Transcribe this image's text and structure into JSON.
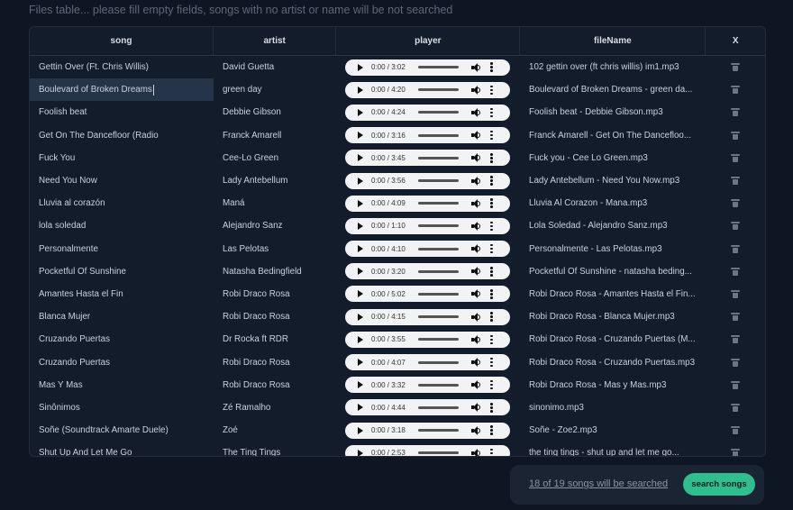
{
  "hint": "Files table... please fill empty fields, songs with no artist or name will be not searched",
  "columns": {
    "song": "song",
    "artist": "artist",
    "player": "player",
    "file": "fileName",
    "x": "X"
  },
  "rows": [
    {
      "song": "Gettin Over (Ft. Chris Willis)",
      "artist": "David Guetta",
      "time": "0:00 / 3:02",
      "file": "102 gettin over (ft chris willis) im1.mp3"
    },
    {
      "song": "Boulevard of Broken Dreams",
      "artist": "green day",
      "time": "0:00 / 4:20",
      "file": "Boulevard of Broken Dreams - green da..."
    },
    {
      "song": "Foolish beat",
      "artist": "Debbie Gibson",
      "time": "0:00 / 4:24",
      "file": "Foolish beat - Debbie Gibson.mp3"
    },
    {
      "song": "Get On The Dancefloor (Radio",
      "artist": "Franck Amarell",
      "time": "0:00 / 3:16",
      "file": "Franck Amarell - Get On The Dancefloo..."
    },
    {
      "song": "Fuck You",
      "artist": "Cee-Lo Green",
      "time": "0:00 / 3:45",
      "file": "Fuck you - Cee Lo Green.mp3"
    },
    {
      "song": "Need You Now",
      "artist": "Lady Antebellum",
      "time": "0:00 / 3:56",
      "file": "Lady Antebellum - Need You Now.mp3"
    },
    {
      "song": "Lluvia al corazón",
      "artist": "Maná",
      "time": "0:00 / 4:09",
      "file": "Lluvia Al Corazon - Mana.mp3"
    },
    {
      "song": "lola soledad",
      "artist": "Alejandro Sanz",
      "time": "0:00 / 1:10",
      "file": "Lola Soledad - Alejandro Sanz.mp3"
    },
    {
      "song": "Personalmente",
      "artist": "Las Pelotas",
      "time": "0:00 / 4:10",
      "file": "Personalmente - Las Pelotas.mp3"
    },
    {
      "song": "Pocketful Of Sunshine",
      "artist": "Natasha Bedingfield",
      "time": "0:00 / 3:20",
      "file": "Pocketful Of Sunshine - natasha beding..."
    },
    {
      "song": "Amantes Hasta el Fin",
      "artist": "Robi Draco Rosa",
      "time": "0:00 / 5:02",
      "file": "Robi Draco Rosa - Amantes Hasta el Fin..."
    },
    {
      "song": "Blanca Mujer",
      "artist": "Robi Draco Rosa",
      "time": "0:00 / 4:15",
      "file": "Robi Draco Rosa - Blanca Mujer.mp3"
    },
    {
      "song": "Cruzando Puertas",
      "artist": "Dr Rocka ft RDR",
      "time": "0:00 / 3:55",
      "file": "Robi Draco Rosa - Cruzando Puertas (M..."
    },
    {
      "song": "Cruzando Puertas",
      "artist": "Robi Draco Rosa",
      "time": "0:00 / 4:07",
      "file": "Robi Draco Rosa - Cruzando Puertas.mp3"
    },
    {
      "song": "Mas Y Mas",
      "artist": "Robi Draco Rosa",
      "time": "0:00 / 3:32",
      "file": "Robi Draco Rosa - Mas y Mas.mp3"
    },
    {
      "song": "Sinônimos",
      "artist": "Zé Ramalho",
      "time": "0:00 / 4:44",
      "file": "sinonimo.mp3"
    },
    {
      "song": "Soñe (Soundtrack Amarte Duele)",
      "artist": "Zoé",
      "time": "0:00 / 3:18",
      "file": "Soñe - Zoe2.mp3"
    },
    {
      "song": "Shut Up And Let Me Go",
      "artist": "The Ting Tings",
      "time": "0:00 / 2:53",
      "file": "the ting tings - shut up and let me go..."
    }
  ],
  "selected_row": 1,
  "footer": {
    "count_text": "18 of 19 songs will be searched",
    "search_label": "search songs"
  },
  "colors": {
    "accent": "#2fbf8f",
    "background": "#0f1623"
  },
  "icons": {
    "play": "play-icon",
    "volume": "volume-icon",
    "more": "more-vert-icon",
    "delete": "trash-icon"
  }
}
